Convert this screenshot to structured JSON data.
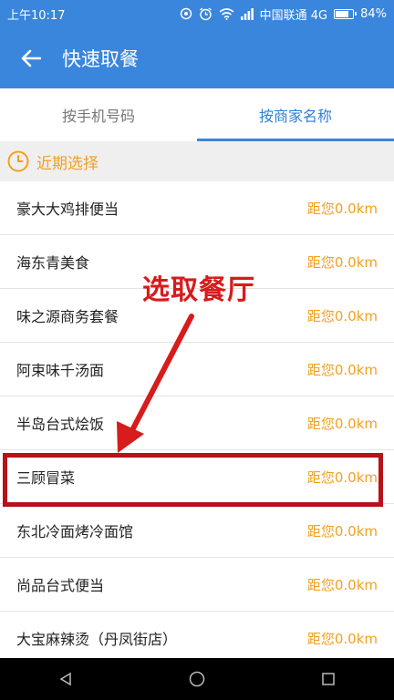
{
  "status_bar": {
    "time": "上午10:17",
    "carrier": "中国联通 4G",
    "battery": "84%",
    "battery_level": 0.84
  },
  "app_bar": {
    "title": "快速取餐",
    "back_icon": "arrow-left-icon"
  },
  "tabs": [
    {
      "label": "按手机号码",
      "active": false
    },
    {
      "label": "按商家名称",
      "active": true
    }
  ],
  "section": {
    "label": "近期选择",
    "icon": "clock-icon"
  },
  "restaurants": [
    {
      "name": "豪大大鸡排便当",
      "distance": "距您0.0km"
    },
    {
      "name": "海东青美食",
      "distance": "距您0.0km"
    },
    {
      "name": "味之源商务套餐",
      "distance": "距您0.0km"
    },
    {
      "name": "阿束味千汤面",
      "distance": "距您0.0km"
    },
    {
      "name": "半岛台式烩饭",
      "distance": "距您0.0km"
    },
    {
      "name": "三顾冒菜",
      "distance": "距您0.0km"
    },
    {
      "name": "东北冷面烤冷面馆",
      "distance": "距您0.0km"
    },
    {
      "name": "尚品台式便当",
      "distance": "距您0.0km"
    },
    {
      "name": "大宝麻辣烫（丹凤街店）",
      "distance": "距您0.0km"
    }
  ],
  "annotation": {
    "text": "选取餐厅",
    "color": "#d81b1b"
  },
  "colors": {
    "primary": "#3a86dc",
    "accent": "#f3a01f"
  }
}
